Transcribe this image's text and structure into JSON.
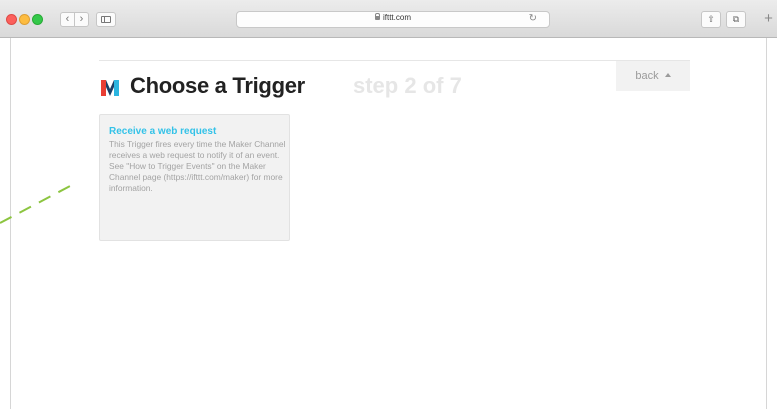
{
  "browser": {
    "url": "ifttt.com",
    "nav_back_glyph": "‹",
    "nav_forward_glyph": "›",
    "reload_glyph": "↻",
    "share_glyph": "⇧",
    "tabs_glyph": "⧉",
    "new_tab_glyph": "+",
    "icons": [
      "traffic-lights",
      "back-icon",
      "forward-icon",
      "sidebar-icon",
      "lock-icon",
      "reload-icon",
      "share-icon",
      "tabs-icon",
      "new-tab-icon"
    ]
  },
  "page": {
    "title": "Choose a Trigger",
    "step": "step 2 of 7",
    "back_label": "back",
    "logo_colors": {
      "left": "#e83e34",
      "middle": "#1a3f66",
      "right": "#2bb5e0"
    }
  },
  "triggers": [
    {
      "title": "Receive a web request",
      "description": "This Trigger fires every time the Maker Channel receives a web request to notify it of an event. See \"How to Trigger Events\" on the Maker Channel page (https://ifttt.com/maker) for more information."
    }
  ],
  "colors": {
    "accent_link": "#33c2e8",
    "dashed_line": "#8cc540"
  }
}
